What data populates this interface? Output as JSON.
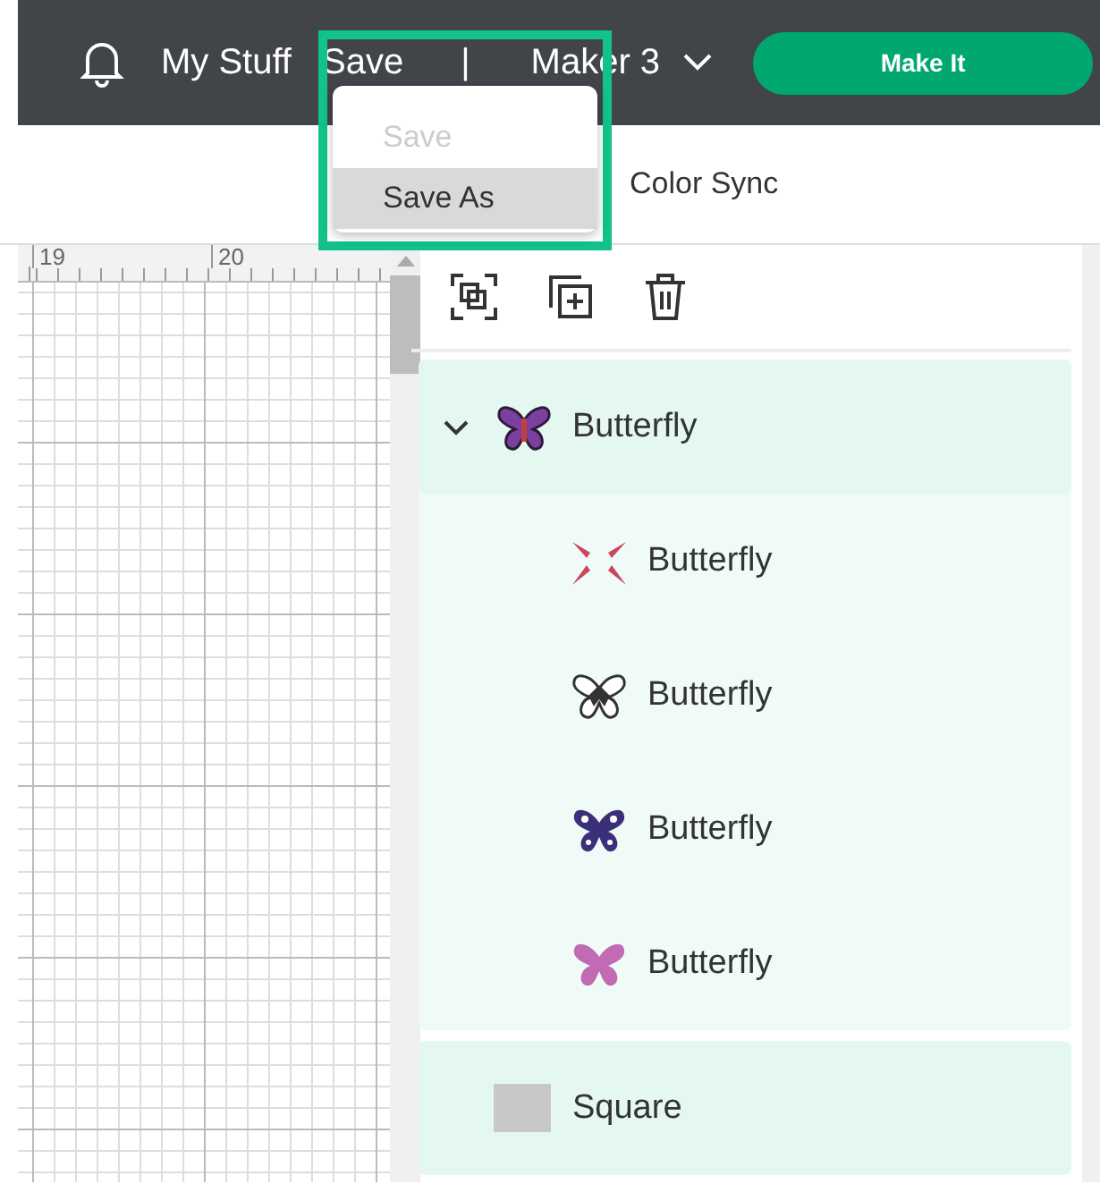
{
  "top_bar": {
    "my_stuff": "My Stuff",
    "save": "Save",
    "separator": "|",
    "machine": "Maker 3",
    "make_it": "Make It"
  },
  "save_menu": {
    "items": [
      {
        "label": "Save",
        "disabled": true,
        "selected": false
      },
      {
        "label": "Save As",
        "disabled": false,
        "selected": true
      }
    ]
  },
  "sub_bar": {
    "color_sync": "Color Sync"
  },
  "canvas": {
    "ruler_labels": [
      "19",
      "20"
    ]
  },
  "layers": [
    {
      "name": "Butterfly",
      "kind": "group",
      "expanded": true,
      "children": [
        {
          "name": "Butterfly",
          "kind": "cut",
          "color": "#c9485b"
        },
        {
          "name": "Butterfly",
          "kind": "outline",
          "color": "#333333"
        },
        {
          "name": "Butterfly",
          "kind": "print",
          "color": "#3b2f7a"
        },
        {
          "name": "Butterfly",
          "kind": "solid",
          "color": "#c06bb4"
        }
      ]
    },
    {
      "name": "Square",
      "kind": "shape",
      "color": "#c8c8c8"
    }
  ]
}
